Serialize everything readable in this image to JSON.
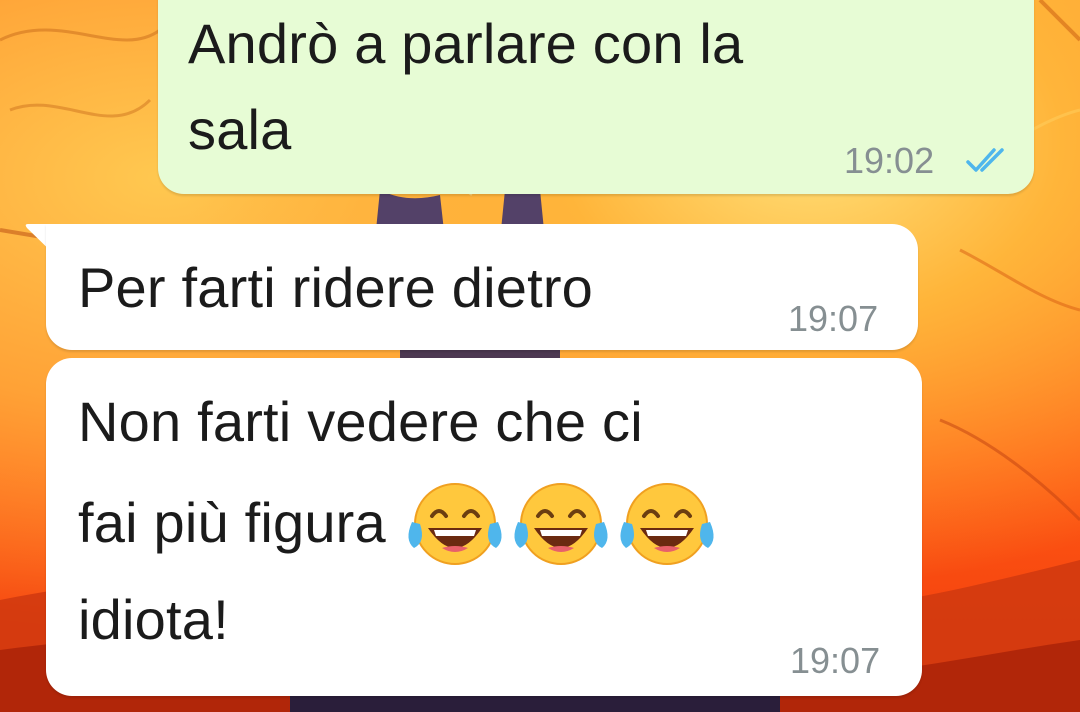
{
  "messages": [
    {
      "direction": "outgoing",
      "line1": "Andrò a parlare con la",
      "line2": "sala",
      "time": "19:02",
      "status_icon": "double-check-read-icon"
    },
    {
      "direction": "incoming",
      "line1": "Per farti ridere dietro",
      "time": "19:07"
    },
    {
      "direction": "incoming",
      "line1": "Non farti vedere che ci",
      "line2": "fai più figura",
      "line3": "idiota!",
      "emojis": [
        "face-with-tears-of-joy-icon",
        "face-with-tears-of-joy-icon",
        "face-with-tears-of-joy-icon"
      ],
      "time": "19:07"
    }
  ],
  "colors": {
    "outgoing_bubble": "#e7fcd5",
    "incoming_bubble": "#ffffff",
    "timestamp": "#868f92",
    "read_ticks": "#4fb6ec"
  }
}
